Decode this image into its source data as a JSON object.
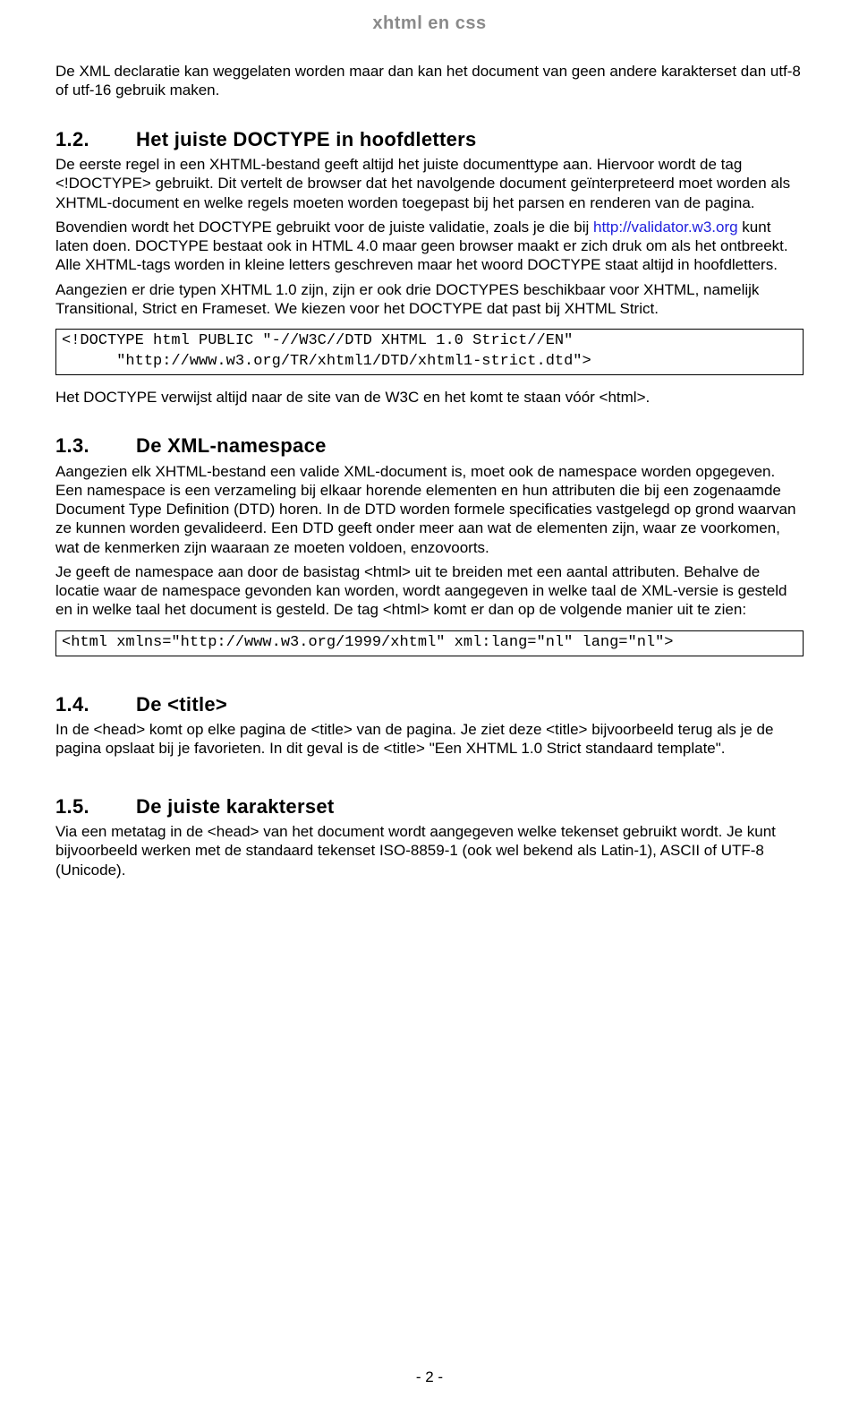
{
  "header": {
    "title": "xhtml en css"
  },
  "intro": {
    "p1": "De XML declaratie kan weggelaten worden maar dan kan het document van geen andere karakterset dan utf-8 of utf-16 gebruik maken."
  },
  "sec12": {
    "num": "1.2.",
    "title": "Het juiste DOCTYPE in hoofdletters",
    "p1a": "De eerste regel in een XHTML-bestand geeft altijd het juiste documenttype aan. Hiervoor wordt de tag <!DOCTYPE> gebruikt. Dit vertelt de browser dat het navolgende document geïnterpreteerd moet worden als XHTML-document en welke regels moeten worden toegepast bij het parsen en renderen van de pagina.",
    "p1b_pre": "Bovendien wordt het DOCTYPE gebruikt voor de juiste validatie, zoals je die bij ",
    "p1b_link": "http://validator.w3.org",
    "p1b_post": " kunt laten doen. DOCTYPE bestaat ook in HTML 4.0 maar geen browser maakt er zich druk om als het ontbreekt. Alle XHTML-tags worden in kleine letters geschreven maar het woord DOCTYPE staat altijd in hoofdletters.",
    "p1c": "Aangezien er drie typen XHTML 1.0 zijn, zijn er ook drie DOCTYPES beschikbaar voor XHTML, namelijk Transitional, Strict en Frameset. We kiezen voor het DOCTYPE dat past bij XHTML Strict.",
    "code": "<!DOCTYPE html PUBLIC \"-//W3C//DTD XHTML 1.0 Strict//EN\"\n      \"http://www.w3.org/TR/xhtml1/DTD/xhtml1-strict.dtd\">",
    "p2": "Het DOCTYPE verwijst altijd naar de site van de W3C en het komt te staan vóór <html>."
  },
  "sec13": {
    "num": "1.3.",
    "title": "De XML-namespace",
    "p1": "Aangezien elk XHTML-bestand een valide XML-document is, moet ook de namespace worden opgegeven. Een namespace is een verzameling bij elkaar horende elementen en hun attributen die bij een zogenaamde Document Type Definition (DTD) horen. In de DTD worden formele specificaties vastgelegd op grond waarvan ze kunnen worden gevalideerd. Een DTD geeft onder meer aan wat de elementen zijn, waar ze voorkomen, wat de kenmerken zijn waaraan ze moeten voldoen, enzovoorts.",
    "p2": "Je geeft de namespace aan door de basistag <html> uit te breiden met een aantal attributen. Behalve de locatie waar de namespace gevonden kan worden, wordt aangegeven in welke taal de XML-versie is gesteld en in welke taal het document is gesteld. De tag <html> komt er dan op de volgende manier uit te zien:",
    "code": "<html xmlns=\"http://www.w3.org/1999/xhtml\" xml:lang=\"nl\" lang=\"nl\">"
  },
  "sec14": {
    "num": "1.4.",
    "title": "De <title>",
    "p1": "In de <head> komt op elke pagina de <title> van de pagina. Je ziet deze <title> bijvoorbeeld terug als je de pagina opslaat bij je favorieten. In dit geval is de <title> \"Een XHTML 1.0 Strict standaard template\"."
  },
  "sec15": {
    "num": "1.5.",
    "title": "De juiste karakterset",
    "p1": "Via een metatag in de <head> van het document wordt aangegeven welke tekenset gebruikt wordt. Je kunt bijvoorbeeld werken met de standaard tekenset ISO-8859-1 (ook wel bekend als Latin-1), ASCII of UTF-8 (Unicode)."
  },
  "footer": {
    "page": "- 2 -"
  }
}
